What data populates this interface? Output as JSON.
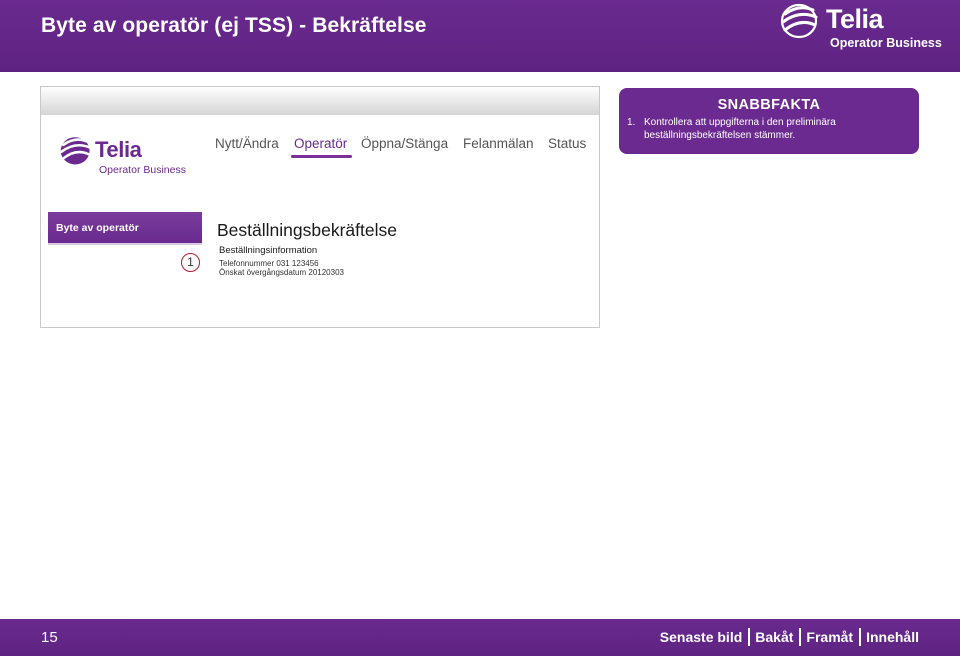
{
  "header": {
    "title": "Byte av operatör (ej TSS) - Bekräftelse",
    "brand_name": "Telia",
    "brand_sub": "Operator Business"
  },
  "screenshot": {
    "logo_name": "Telia",
    "logo_sub": "Operator Business",
    "nav": [
      "Nytt/Ändra",
      "Operatör",
      "Öppna/Stänga",
      "Felanmälan",
      "Status"
    ],
    "nav_active": "Operatör",
    "left_menu_label": "Byte av operatör",
    "step_marker": "1",
    "content_title": "Beställningsbekräftelse",
    "section_title": "Beställningsinformation",
    "info_lines": [
      "Telefonnummer 031 123456",
      "Önskat övergångsdatum 20120303"
    ]
  },
  "quick_facts": {
    "title": "SNABBFAKTA",
    "items": [
      {
        "number": "1.",
        "text": "Kontrollera att uppgifterna i den preliminära beställningsbekräftelsen stämmer."
      }
    ]
  },
  "footer": {
    "page_number": "15",
    "links": [
      "Senaste bild",
      "Bakåt",
      "Framåt",
      "Innehåll"
    ]
  },
  "colors": {
    "brand_purple": "#6a2a8f",
    "step_marker_red": "#b11c2e"
  },
  "icons": [
    "telia-logo-icon"
  ]
}
